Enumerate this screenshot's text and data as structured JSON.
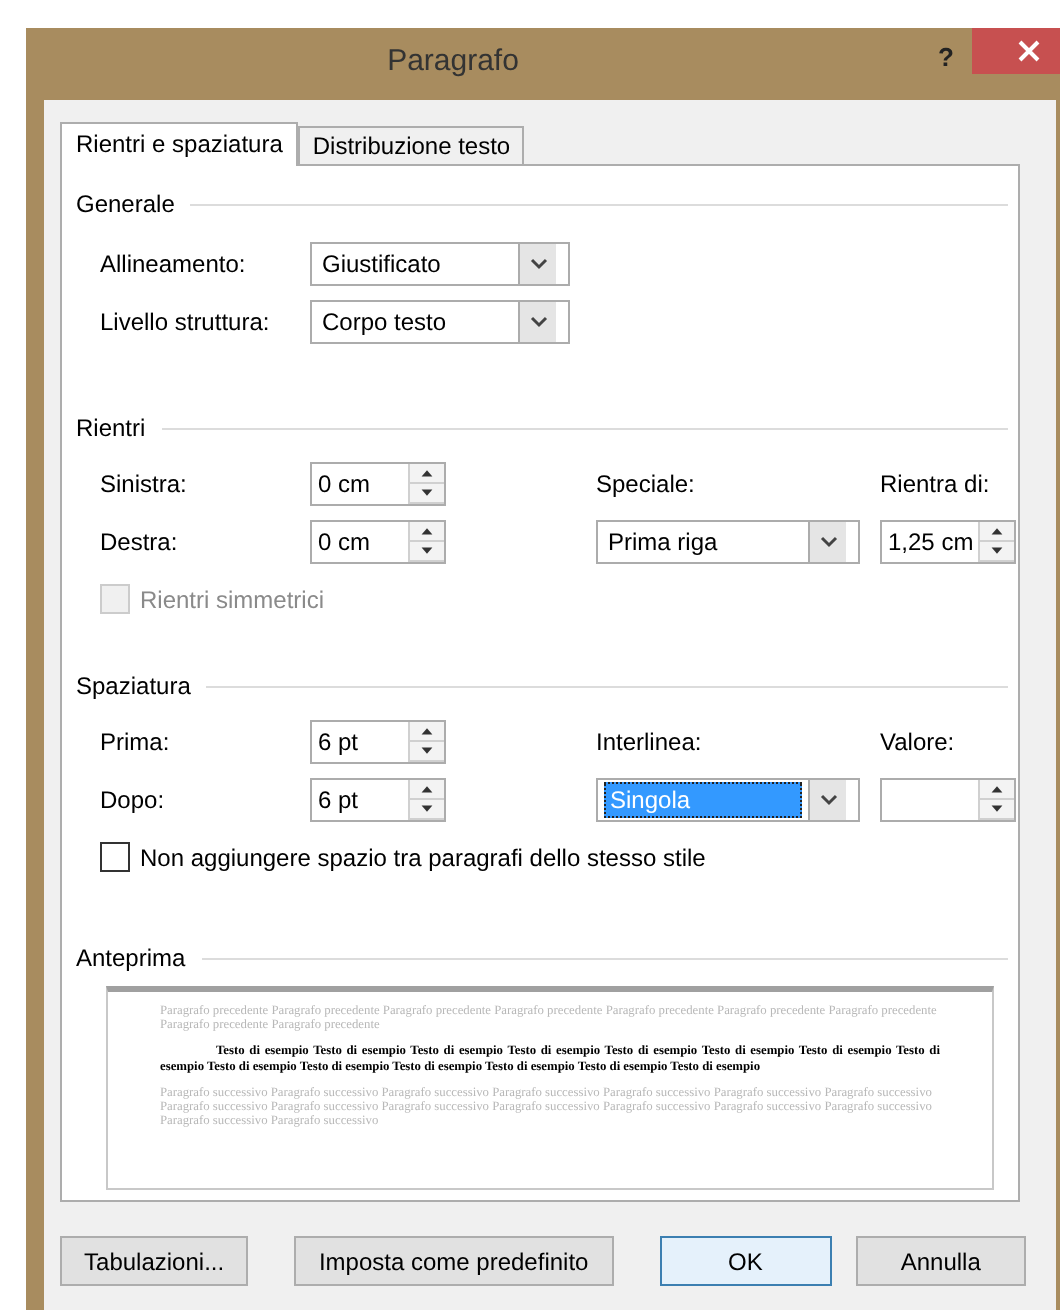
{
  "window": {
    "title": "Paragrafo",
    "help": "?"
  },
  "tabs": [
    {
      "label": "Rientri e spaziatura",
      "selected": true
    },
    {
      "label": "Distribuzione testo",
      "selected": false
    }
  ],
  "sections": [
    {
      "title": "Generale",
      "rows": [
        [
          {
            "kind": "label",
            "text": "Allineamento:"
          },
          {
            "kind": "dropdown",
            "value": "Giustificato",
            "highlighted": false
          }
        ],
        [
          {
            "kind": "label",
            "text": "Livello struttura:"
          },
          {
            "kind": "dropdown",
            "value": "Corpo testo",
            "highlighted": false
          }
        ]
      ]
    },
    {
      "title": "Rientri",
      "rows": [
        [
          {
            "kind": "label",
            "text": "Sinistra:"
          },
          {
            "kind": "spinner",
            "value": "0 cm"
          },
          {
            "kind": "label",
            "text": "Speciale:"
          },
          {
            "kind": "label",
            "text": "Rientra di:"
          }
        ],
        [
          {
            "kind": "label",
            "text": "Destra:"
          },
          {
            "kind": "spinner",
            "value": "0 cm"
          },
          {
            "kind": "dropdown",
            "value": "Prima riga",
            "highlighted": false
          },
          {
            "kind": "spinner",
            "value": "1,25 cm"
          }
        ],
        [
          {
            "kind": "checkbox",
            "text": "Rientri simmetrici",
            "checked": false,
            "disabled": true
          }
        ]
      ]
    },
    {
      "title": "Spaziatura",
      "rows": [
        [
          {
            "kind": "label",
            "text": "Prima:"
          },
          {
            "kind": "spinner",
            "value": "6 pt"
          },
          {
            "kind": "label",
            "text": "Interlinea:"
          },
          {
            "kind": "label",
            "text": "Valore:"
          }
        ],
        [
          {
            "kind": "label",
            "text": "Dopo:"
          },
          {
            "kind": "spinner",
            "value": "6 pt"
          },
          {
            "kind": "dropdown",
            "value": "Singola",
            "highlighted": true
          },
          {
            "kind": "spinner"
          }
        ],
        [
          {
            "kind": "checkbox",
            "text": "Non aggiungere spazio tra paragrafi dello stesso stile",
            "checked": false,
            "disabled": false
          }
        ]
      ]
    }
  ],
  "preview": {
    "title": "Anteprima",
    "preceding": "Paragrafo precedente Paragrafo precedente Paragrafo precedente Paragrafo precedente Paragrafo precedente Paragrafo precedente Paragrafo precedente Paragrafo precedente Paragrafo precedente",
    "sample": "Testo di esempio Testo di esempio Testo di esempio Testo di esempio Testo di esempio Testo di esempio Testo di esempio Testo di esempio Testo di esempio Testo di esempio Testo di esempio Testo di esempio Testo di esempio Testo di esempio",
    "following": "Paragrafo successivo Paragrafo successivo Paragrafo successivo Paragrafo successivo Paragrafo successivo Paragrafo successivo Paragrafo successivo Paragrafo successivo Paragrafo successivo Paragrafo successivo Paragrafo successivo Paragrafo successivo Paragrafo successivo Paragrafo successivo Paragrafo successivo Paragrafo successivo"
  },
  "buttons": [
    {
      "label": "Tabulazioni...",
      "default": false
    },
    {
      "label": "Imposta come predefinito",
      "default": false
    },
    {
      "label": "OK",
      "default": true
    },
    {
      "label": "Annulla",
      "default": false
    }
  ]
}
